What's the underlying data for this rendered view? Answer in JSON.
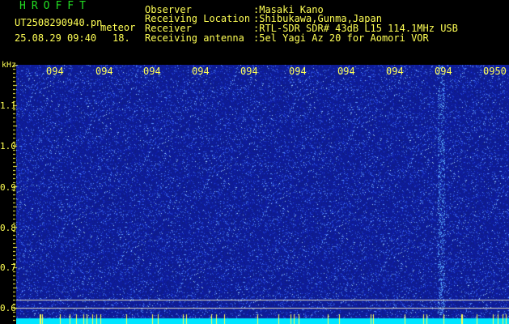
{
  "header": {
    "app_title": "HROFFT",
    "file_name": "UT2508290940.pn",
    "meteor_label": "meteor",
    "date_time": "25.08.29 09:40",
    "count": "18."
  },
  "info": {
    "observer_label": "Observer",
    "observer_value": ":Masaki Kano",
    "location_label": "Receiving Location",
    "location_value": ":Shibukawa,Gunma,Japan",
    "receiver_label": "Receiver",
    "receiver_value": ":RTL-SDR SDR# 43dB L15 114.1MHz USB",
    "antenna_label": "Receiving antenna",
    "antenna_value": ":5el Yagi Az 20 for Aomori VOR"
  },
  "axis": {
    "unit": "kHz",
    "y_ticks": [
      "1.1",
      "1.0",
      "0.9",
      "0.8",
      "0.7",
      "0.6"
    ],
    "x_ticks": [
      "094",
      "094",
      "094",
      "094",
      "094",
      "094",
      "094",
      "094",
      "094",
      "0950"
    ]
  },
  "colors": {
    "text": "#ffff55",
    "title": "#22dd22",
    "background": "#000000",
    "spectrogram_base": "#14228a",
    "noise_bar": "#00e5ff",
    "marker_line": "#d8d8c0"
  }
}
